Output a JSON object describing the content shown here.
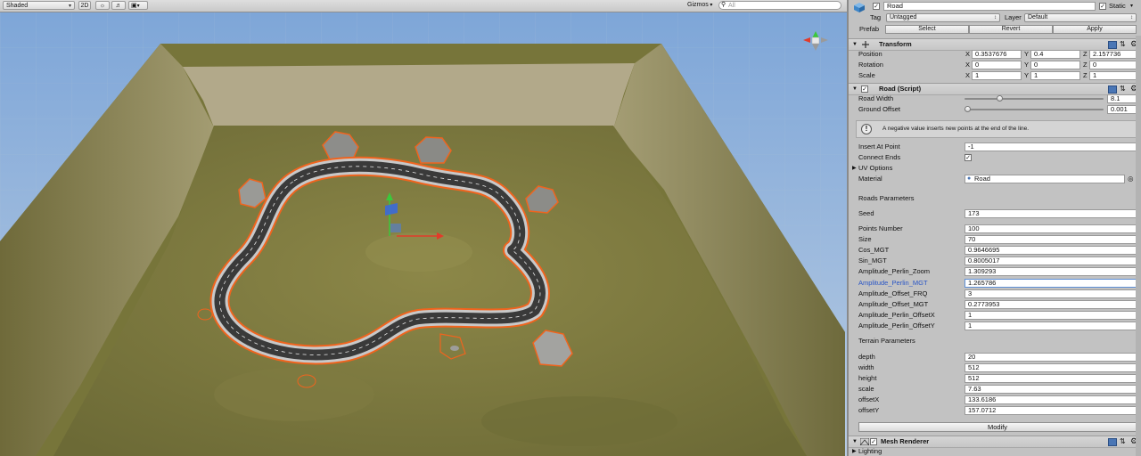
{
  "scene_toolbar": {
    "draw_mode": "Shaded",
    "mode_2d": "2D",
    "lighting_icon": "sun-icon",
    "audio_icon": "speaker-icon",
    "effects_icon": "image-icon",
    "gizmos": "Gizmos",
    "search_placeholder": "All"
  },
  "inspector": {
    "object_name": "Road",
    "static_label": "Static",
    "tag_label": "Tag",
    "tag_value": "Untagged",
    "layer_label": "Layer",
    "layer_value": "Default",
    "prefab_label": "Prefab",
    "prefab_buttons": [
      "Select",
      "Revert",
      "Apply"
    ],
    "transform": {
      "title": "Transform",
      "rows": [
        {
          "label": "Position",
          "x": "0.3537676",
          "y": "0.4",
          "z": "2.157736"
        },
        {
          "label": "Rotation",
          "x": "0",
          "y": "0",
          "z": "0"
        },
        {
          "label": "Scale",
          "x": "1",
          "y": "1",
          "z": "1"
        }
      ]
    },
    "road_script": {
      "title": "Road (Script)",
      "road_width_label": "Road Width",
      "road_width_value": "8.1",
      "road_width_fraction": 0.1,
      "ground_offset_label": "Ground Offset",
      "ground_offset_value": "0.001",
      "ground_offset_fraction": 0.0,
      "help_text": "A negative value inserts new points at the end of the line.",
      "insert_at_point_label": "Insert At Point",
      "insert_at_point_value": "-1",
      "connect_ends_label": "Connect Ends",
      "connect_ends_checked": true,
      "uv_options_label": "UV Options",
      "material_label": "Material",
      "material_value": "Road",
      "roads_parameters_header": "Roads Parameters",
      "seed_label": "Seed",
      "seed_value": "173",
      "road_params": [
        {
          "label": "Points Number",
          "value": "100"
        },
        {
          "label": "Size",
          "value": "70"
        },
        {
          "label": "Cos_MGT",
          "value": "0.9646695"
        },
        {
          "label": "Sin_MGT",
          "value": "0.8005017"
        },
        {
          "label": "Amplitude_Perlin_Zoom",
          "value": "1.309293"
        },
        {
          "label": "Amplitude_Perlin_MGT",
          "value": "1.265786"
        },
        {
          "label": "Amplitude_Offset_FRQ",
          "value": "3"
        },
        {
          "label": "Amplitude_Offset_MGT",
          "value": "0.2773953"
        },
        {
          "label": "Amplitude_Perlin_OffsetX",
          "value": "1"
        },
        {
          "label": "Amplitude_Perlin_OffsetY",
          "value": "1"
        }
      ],
      "terrain_parameters_header": "Terrain Parameters",
      "terrain_params": [
        {
          "label": "depth",
          "value": "20"
        },
        {
          "label": "width",
          "value": "512"
        },
        {
          "label": "height",
          "value": "512"
        },
        {
          "label": "scale",
          "value": "7.63"
        },
        {
          "label": "offsetX",
          "value": "133.6186"
        },
        {
          "label": "offsetY",
          "value": "157.0712"
        }
      ],
      "modify_button": "Modify"
    },
    "mesh_renderer": {
      "title": "Mesh Renderer"
    },
    "lighting_label": "Lighting"
  },
  "colors": {
    "terrain_grass": "#7d7a3f",
    "terrain_cliff": "#8f8a62",
    "road_asphalt": "#3a3a3a",
    "selection_outline": "#f0641e",
    "sky": "#8fb0d8"
  }
}
